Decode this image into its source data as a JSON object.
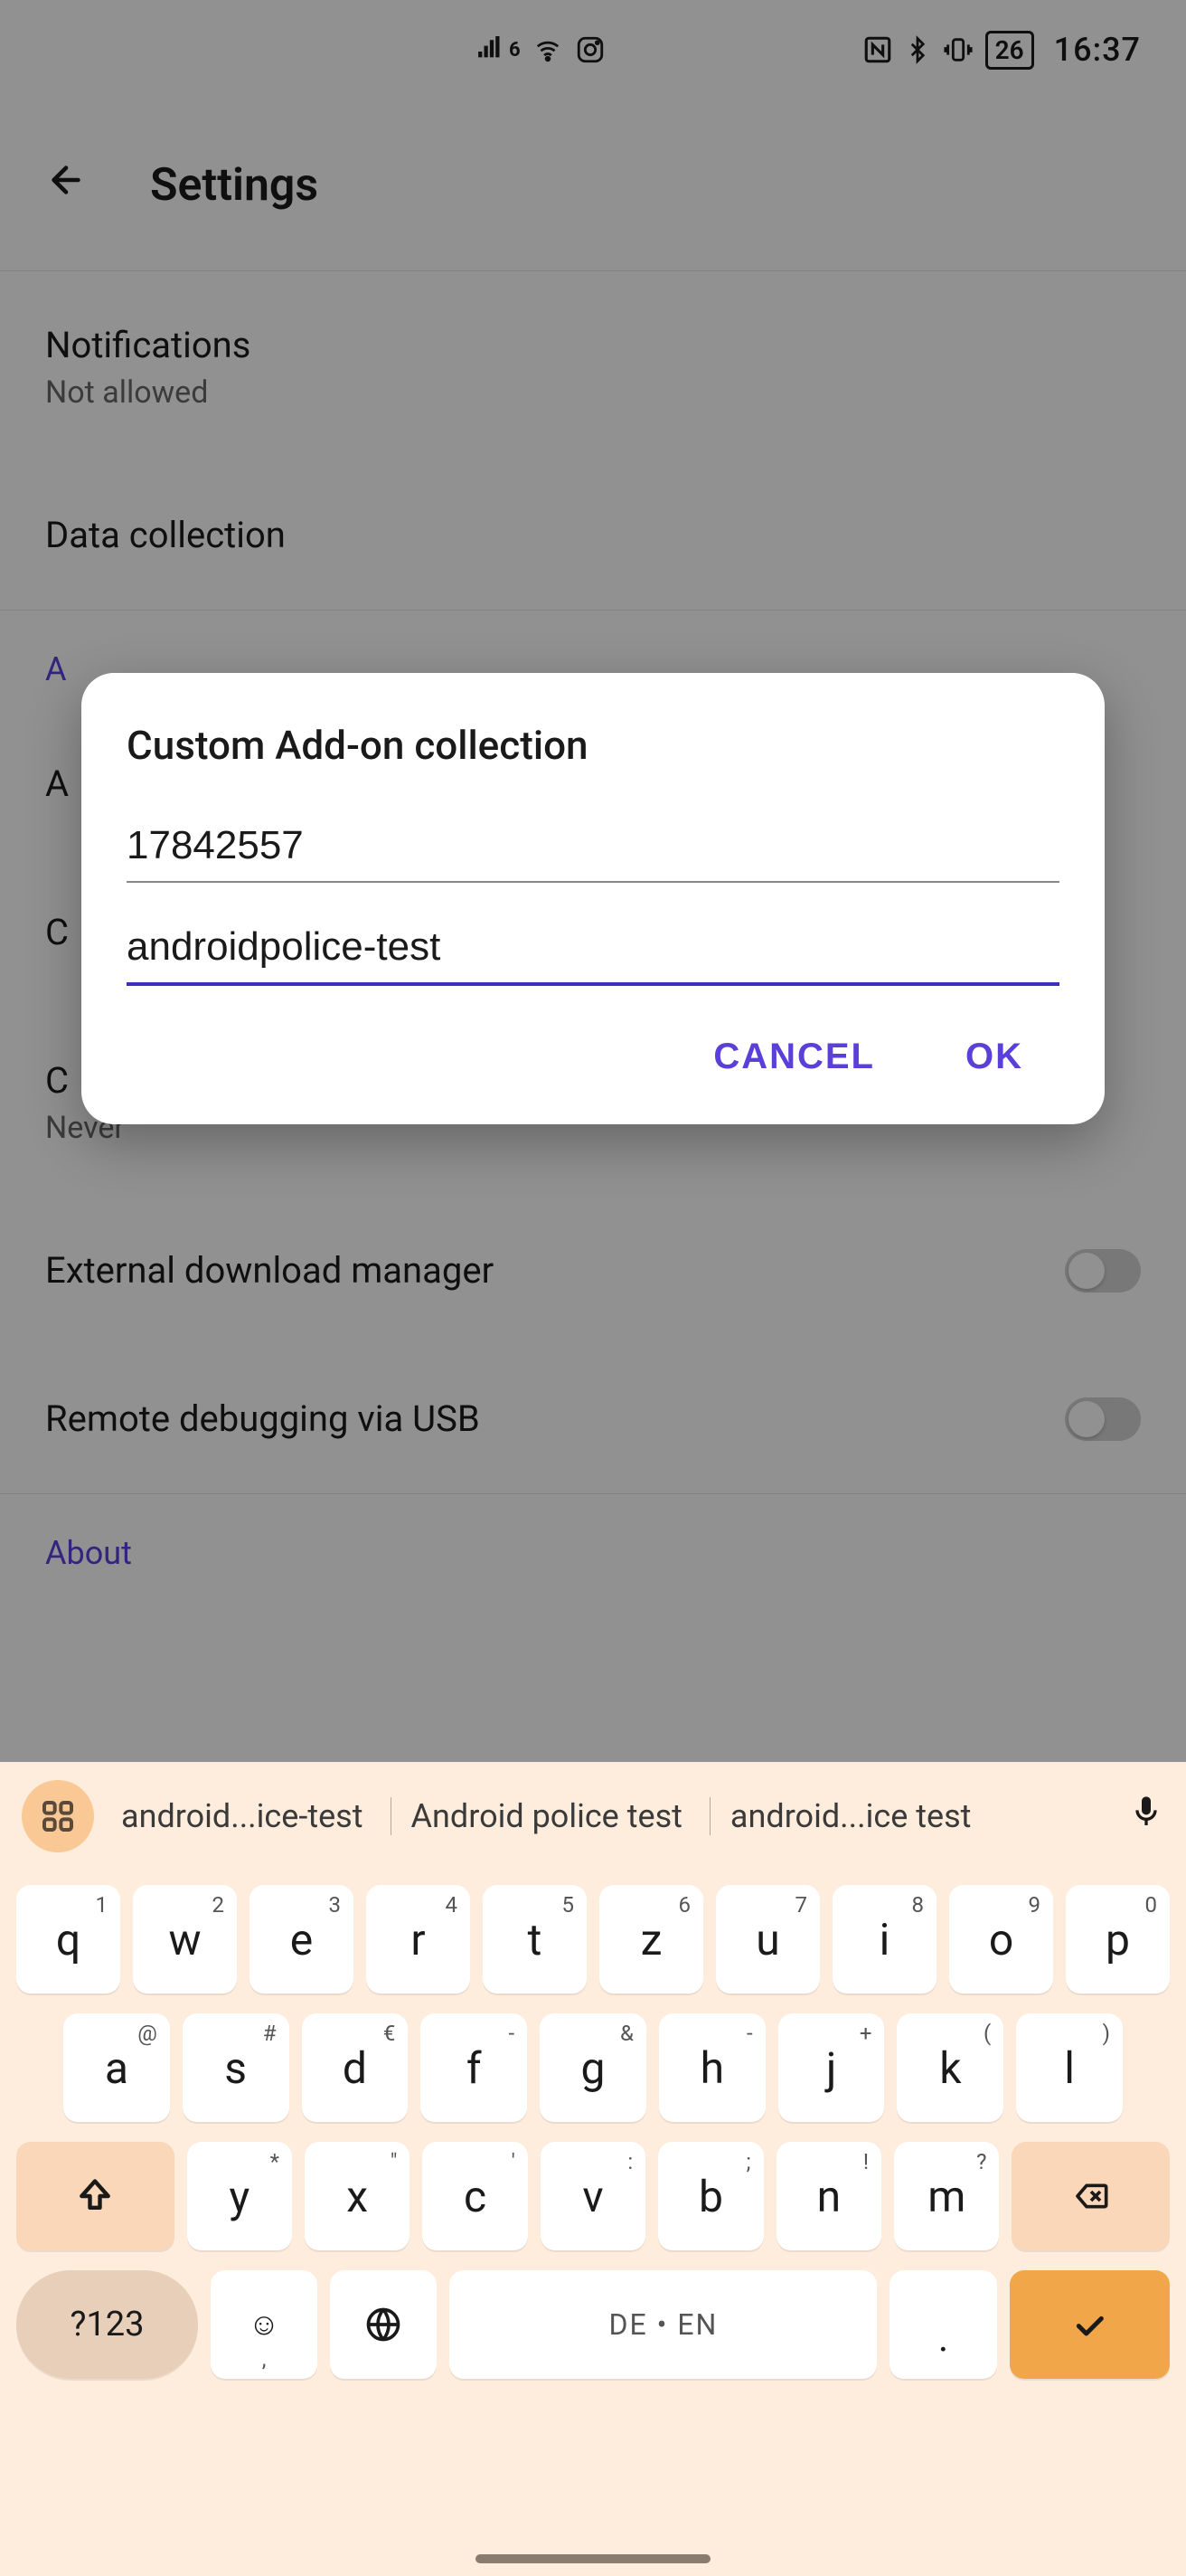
{
  "status": {
    "battery": "26",
    "time": "16:37"
  },
  "header": {
    "title": "Settings"
  },
  "settings": {
    "notifications": {
      "label": "Notifications",
      "sub": "Not allowed"
    },
    "data_collection": {
      "label": "Data collection"
    },
    "section_a": "A",
    "item_a": {
      "label": "A"
    },
    "item_c1": {
      "label": "C"
    },
    "item_c2": {
      "label": "C",
      "sub": "Never"
    },
    "ext_dl": {
      "label": "External download manager"
    },
    "remote_dbg": {
      "label": "Remote debugging via USB"
    },
    "about": "About"
  },
  "dialog": {
    "title": "Custom Add-on collection",
    "field1": "17842557",
    "field2": "androidpolice-test",
    "cancel": "CANCEL",
    "ok": "OK"
  },
  "keyboard": {
    "suggestions": [
      "android...ice-test",
      "Android police test",
      "android...ice test"
    ],
    "row1": [
      {
        "k": "q",
        "s": "1"
      },
      {
        "k": "w",
        "s": "2"
      },
      {
        "k": "e",
        "s": "3"
      },
      {
        "k": "r",
        "s": "4"
      },
      {
        "k": "t",
        "s": "5"
      },
      {
        "k": "z",
        "s": "6"
      },
      {
        "k": "u",
        "s": "7"
      },
      {
        "k": "i",
        "s": "8"
      },
      {
        "k": "o",
        "s": "9"
      },
      {
        "k": "p",
        "s": "0"
      }
    ],
    "row2": [
      {
        "k": "a",
        "s": "@"
      },
      {
        "k": "s",
        "s": "#"
      },
      {
        "k": "d",
        "s": "€"
      },
      {
        "k": "f",
        "s": "-"
      },
      {
        "k": "g",
        "s": "&"
      },
      {
        "k": "h",
        "s": "-"
      },
      {
        "k": "j",
        "s": "+"
      },
      {
        "k": "k",
        "s": "("
      },
      {
        "k": "l",
        "s": ")"
      }
    ],
    "row3": [
      {
        "k": "y",
        "s": "*"
      },
      {
        "k": "x",
        "s": "\""
      },
      {
        "k": "c",
        "s": "'"
      },
      {
        "k": "v",
        "s": ":"
      },
      {
        "k": "b",
        "s": ";"
      },
      {
        "k": "n",
        "s": "!"
      },
      {
        "k": "m",
        "s": "?"
      }
    ],
    "sym": "?123",
    "space": "DE • EN",
    "emoji_sub": ","
  }
}
